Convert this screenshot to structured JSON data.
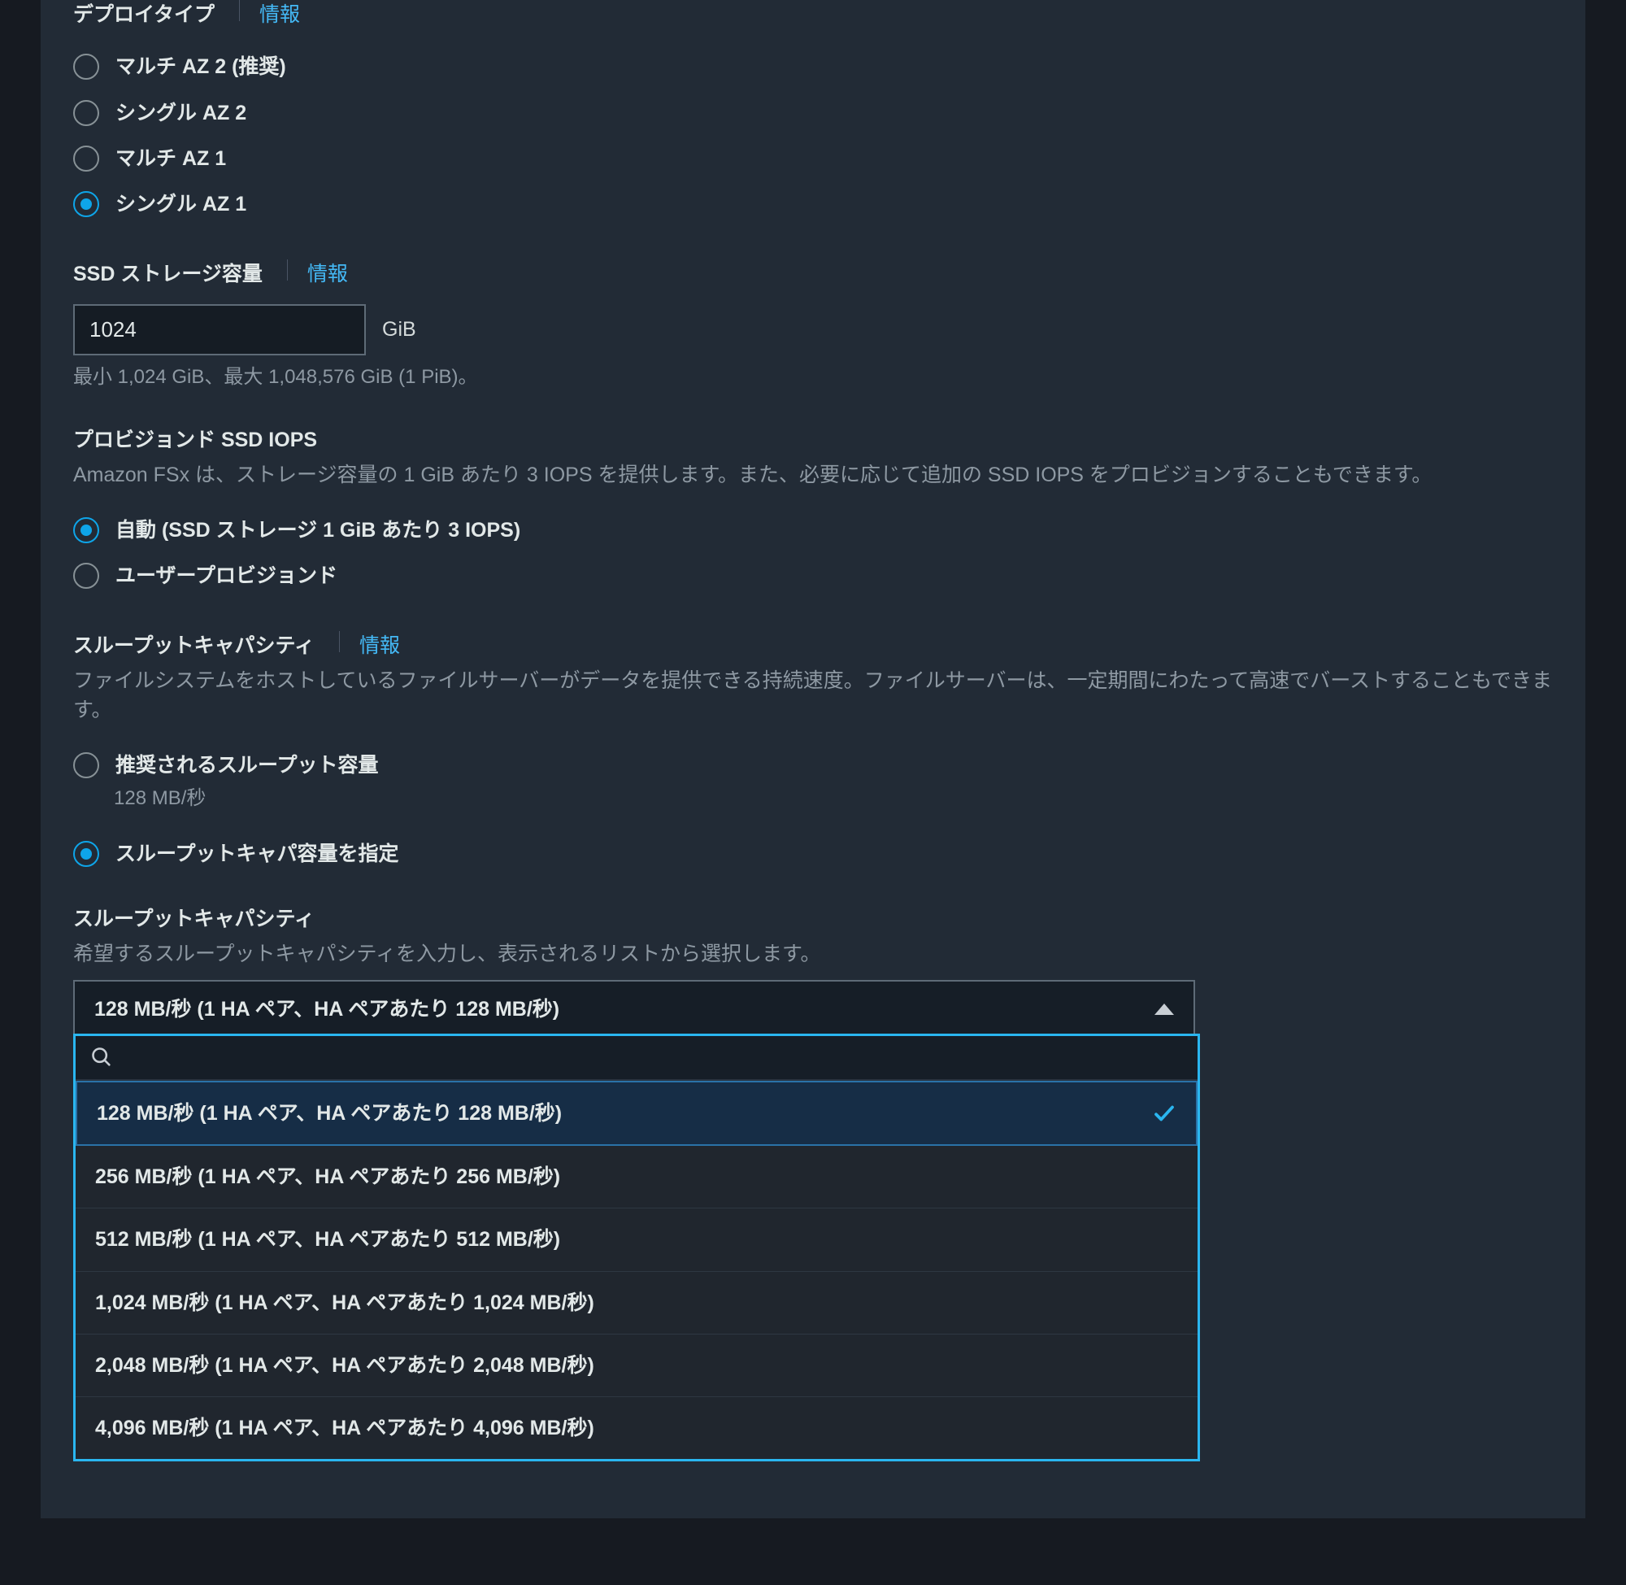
{
  "deploy": {
    "label": "デプロイタイプ",
    "info": "情報",
    "options": [
      "マルチ AZ 2 (推奨)",
      "シングル AZ 2",
      "マルチ AZ 1",
      "シングル AZ 1"
    ],
    "selected_index": 3
  },
  "storage": {
    "label": "SSD ストレージ容量",
    "info": "情報",
    "value": "1024",
    "unit": "GiB",
    "hint": "最小 1,024 GiB、最大 1,048,576 GiB (1 PiB)。"
  },
  "iops": {
    "label": "プロビジョンド SSD IOPS",
    "desc": "Amazon FSx は、ストレージ容量の 1 GiB あたり 3 IOPS を提供します。また、必要に応じて追加の SSD IOPS をプロビジョンすることもできます。",
    "options": [
      "自動 (SSD ストレージ 1 GiB あたり 3 IOPS)",
      "ユーザープロビジョンド"
    ],
    "selected_index": 0
  },
  "throughput_mode": {
    "label": "スループットキャパシティ",
    "info": "情報",
    "desc": "ファイルシステムをホストしているファイルサーバーがデータを提供できる持続速度。ファイルサーバーは、一定期間にわたって高速でバーストすることもできます。",
    "options": [
      {
        "label": "推奨されるスループット容量",
        "sub": "128 MB/秒"
      },
      {
        "label": "スループットキャパ容量を指定",
        "sub": ""
      }
    ],
    "selected_index": 1
  },
  "throughput_select": {
    "label": "スループットキャパシティ",
    "desc": "希望するスループットキャパシティを入力し、表示されるリストから選択します。",
    "current": "128 MB/秒 (1 HA ペア、HA ペアあたり 128 MB/秒)",
    "search_value": "",
    "options": [
      "128 MB/秒 (1 HA ペア、HA ペアあたり 128 MB/秒)",
      "256 MB/秒 (1 HA ペア、HA ペアあたり 256 MB/秒)",
      "512 MB/秒 (1 HA ペア、HA ペアあたり 512 MB/秒)",
      "1,024 MB/秒 (1 HA ペア、HA ペアあたり 1,024 MB/秒)",
      "2,048 MB/秒 (1 HA ペア、HA ペアあたり 2,048 MB/秒)",
      "4,096 MB/秒 (1 HA ペア、HA ペアあたり 4,096 MB/秒)"
    ],
    "selected_index": 0
  }
}
